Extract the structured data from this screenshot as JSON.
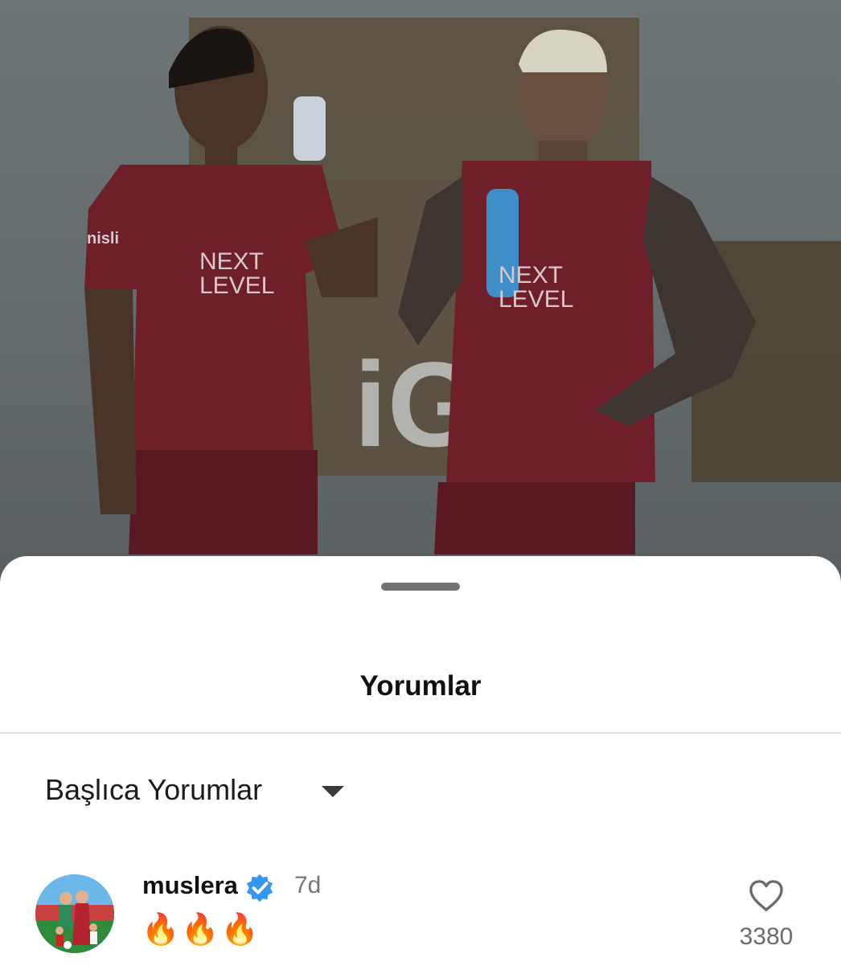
{
  "sheet": {
    "title": "Yorumlar",
    "sort_label": "Başlıca Yorumlar"
  },
  "comments": [
    {
      "username": "muslera",
      "verified": true,
      "time": "7d",
      "text": "🔥🔥🔥",
      "likes": "3380"
    }
  ],
  "background_photo": {
    "jersey_text": "NEXT\nLEVEL",
    "sponsor_text": "nisli",
    "sign_text": "iG"
  },
  "colors": {
    "jersey": "#6e1f2a",
    "verified_badge": "#3797f0",
    "sheet_background": "#ffffff"
  }
}
